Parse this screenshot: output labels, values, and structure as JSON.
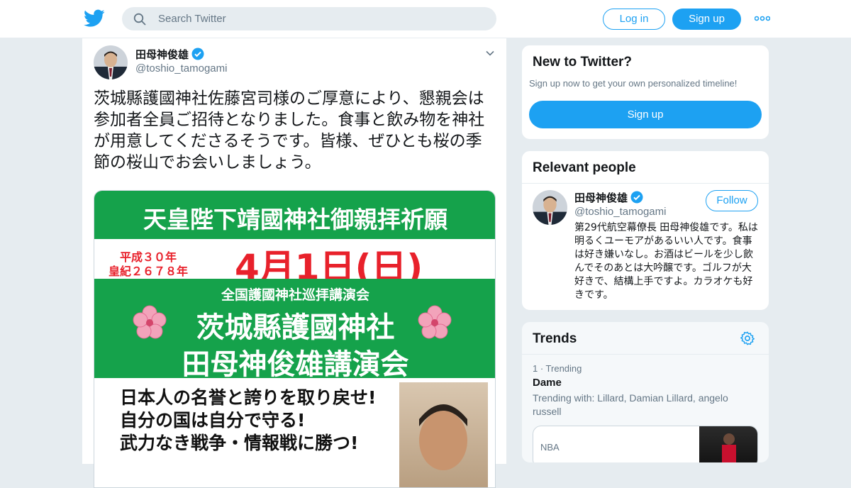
{
  "colors": {
    "accent": "#1da1f2",
    "poster_green": "#15a24b",
    "poster_red": "#e8212b",
    "background": "#e6ecf0"
  },
  "header": {
    "search_placeholder": "Search Twitter",
    "login_label": "Log in",
    "signup_label": "Sign up"
  },
  "tweet": {
    "author_name": "田母神俊雄",
    "author_handle": "@toshio_tamogami",
    "text": "茨城縣護國神社佐藤宮司様のご厚意により、懇親会は参加者全員ご招待となりました。食事と飲み物を神社が用意してくださるそうです。皆様、ぜひとも桜の季節の桜山でお会いしましょう。",
    "poster": {
      "line1": "天皇陛下靖國神社御親拝祈願",
      "era1": "平成３０年",
      "era2": "皇紀２６７８年",
      "date": "4月1日(日)",
      "line3": "全国護國神社巡拝講演会",
      "line4": "茨城縣護國神社",
      "line5": "田母神俊雄講演会",
      "slogan1": "日本人の名誉と誇りを取り戻せ!",
      "slogan2": "自分の国は自分で守る!",
      "slogan3": "武力なき戦争・情報戦に勝つ!"
    }
  },
  "new_to_twitter": {
    "title": "New to Twitter?",
    "subtitle": "Sign up now to get your own personalized timeline!",
    "button": "Sign up"
  },
  "relevant_people": {
    "title": "Relevant people",
    "name": "田母神俊雄",
    "handle": "@toshio_tamogami",
    "follow_label": "Follow",
    "bio": "第29代航空幕僚長 田母神俊雄です。私は明るくユーモアがあるいい人です。食事は好き嫌いなし。お酒はビールを少し飲んでそのあとは大吟醸です。ゴルフが大好きで、結構上手ですよ。カラオケも好きです。"
  },
  "trends": {
    "title": "Trends",
    "items": [
      {
        "meta": "1 · Trending",
        "name": "Dame",
        "with": "Trending with: Lillard, Damian Lillard, angelo russell",
        "card_label": "NBA"
      }
    ]
  }
}
